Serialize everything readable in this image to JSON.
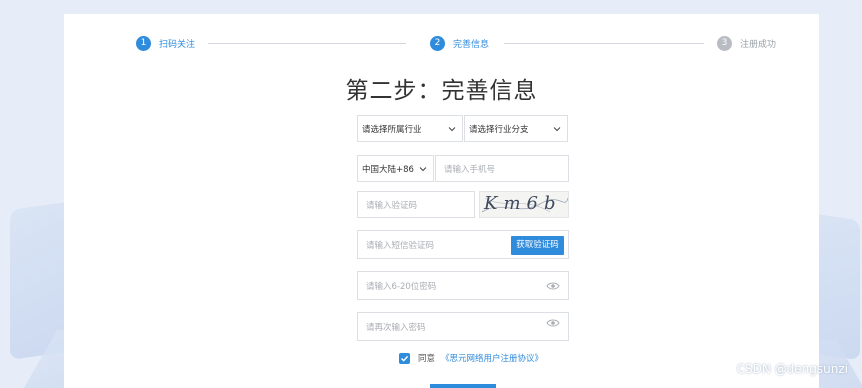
{
  "steps": [
    {
      "num": "1",
      "label": "扫码关注",
      "state": "active"
    },
    {
      "num": "2",
      "label": "完善信息",
      "state": "active"
    },
    {
      "num": "3",
      "label": "注册成功",
      "state": "pending"
    }
  ],
  "title": "第二步：完善信息",
  "form": {
    "industry_select": "请选择所属行业",
    "industry_sub_select": "请选择行业分支",
    "region_select": "中国大陆+86",
    "phone_placeholder": "请输入手机号",
    "captcha_placeholder": "请输入验证码",
    "captcha_image_text": "Km6b",
    "sms_code_placeholder": "请输入短信验证码",
    "sms_button": "获取验证码",
    "password_placeholder": "请输入6-20位密码",
    "confirm_password_placeholder": "请再次输入密码"
  },
  "agreement": {
    "checked": true,
    "label": "同意",
    "link": "《思元网络用户注册协议》"
  },
  "watermark": "CSDN @dengsunzi",
  "colors": {
    "accent": "#2f8bdc",
    "page_bg": "#e7edf8",
    "pending": "#b9bcc2"
  },
  "icons": [
    "chevron-down-icon",
    "eye-icon",
    "checkmark-icon"
  ]
}
